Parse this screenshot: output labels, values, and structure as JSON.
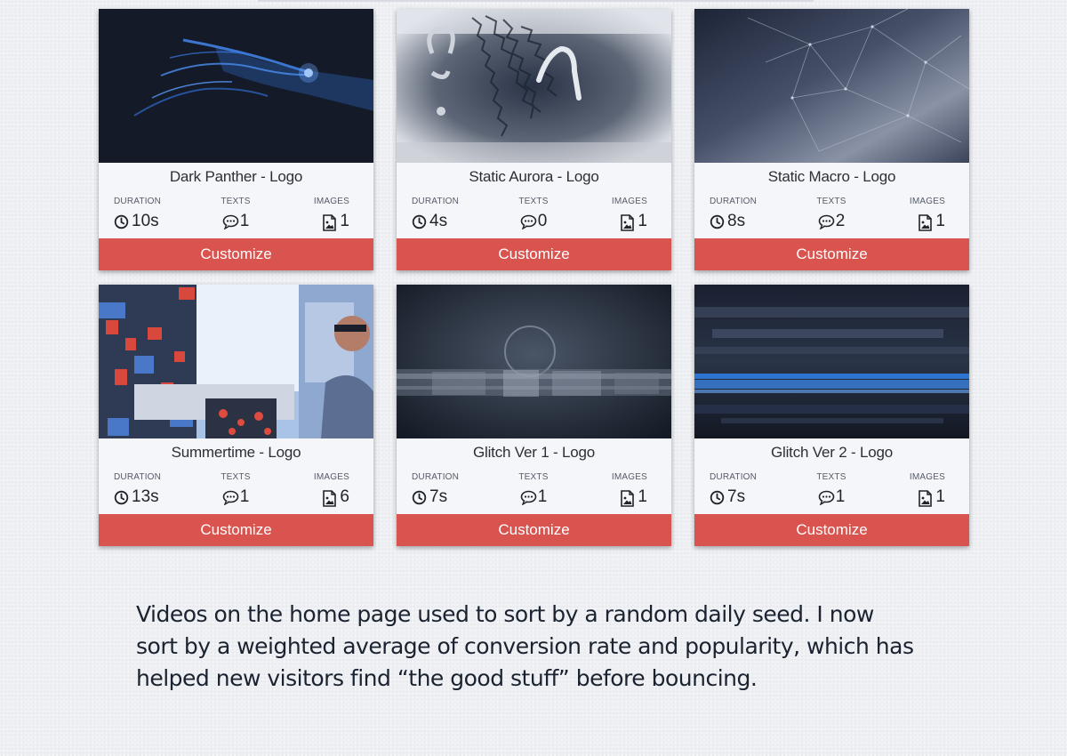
{
  "cards": [
    {
      "title": "Dark Panther - Logo",
      "thumb_name": "dark-panther-preview",
      "labels": {
        "duration": "DURATION",
        "texts": "TEXTS",
        "images": "IMAGES"
      },
      "duration": "10s",
      "texts": "1",
      "images": "1",
      "cta": "Customize"
    },
    {
      "title": "Static Aurora - Logo",
      "thumb_name": "static-aurora-preview",
      "labels": {
        "duration": "DURATION",
        "texts": "TEXTS",
        "images": "IMAGES"
      },
      "duration": "4s",
      "texts": "0",
      "images": "1",
      "cta": "Customize"
    },
    {
      "title": "Static Macro - Logo",
      "thumb_name": "static-macro-preview",
      "labels": {
        "duration": "DURATION",
        "texts": "TEXTS",
        "images": "IMAGES"
      },
      "duration": "8s",
      "texts": "2",
      "images": "1",
      "cta": "Customize"
    },
    {
      "title": "Summertime - Logo",
      "thumb_name": "summertime-preview",
      "labels": {
        "duration": "DURATION",
        "texts": "TEXTS",
        "images": "IMAGES"
      },
      "duration": "13s",
      "texts": "1",
      "images": "6",
      "cta": "Customize"
    },
    {
      "title": "Glitch Ver 1 - Logo",
      "thumb_name": "glitch-ver-1-preview",
      "labels": {
        "duration": "DURATION",
        "texts": "TEXTS",
        "images": "IMAGES"
      },
      "duration": "7s",
      "texts": "1",
      "images": "1",
      "cta": "Customize"
    },
    {
      "title": "Glitch Ver 2 - Logo",
      "thumb_name": "glitch-ver-2-preview",
      "labels": {
        "duration": "DURATION",
        "texts": "TEXTS",
        "images": "IMAGES"
      },
      "duration": "7s",
      "texts": "1",
      "images": "1",
      "cta": "Customize"
    }
  ],
  "icons": {
    "duration": "clock-icon",
    "texts": "comment-icon",
    "images": "image-file-icon"
  },
  "colors": {
    "cta": "#d9534f",
    "card_bg": "#f5f6fa",
    "page_bg": "#eef0f4",
    "text": "#1b2330"
  },
  "caption": {
    "line1": "Videos on the home page used to sort by a random daily seed. I now",
    "line2": "sort by a weighted average of conversion rate and popularity, which has",
    "line3": "helped new visitors find “the good stuff” before bouncing."
  }
}
